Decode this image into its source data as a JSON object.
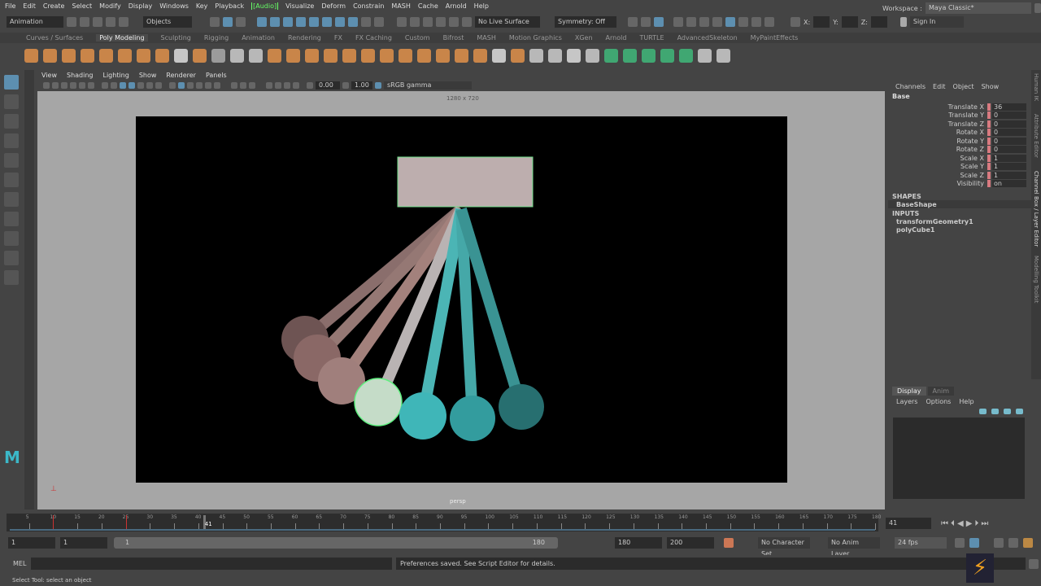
{
  "menu": [
    "File",
    "Edit",
    "Create",
    "Select",
    "Modify",
    "Display",
    "Windows",
    "Key",
    "Playback",
    "[Audio]",
    "Visualize",
    "Deform",
    "Constrain",
    "MASH",
    "Cache",
    "Arnold",
    "Help"
  ],
  "status": {
    "menuset": "Animation",
    "selection_mode": "Objects",
    "live_surface": "No Live Surface",
    "symmetry": "Symmetry: Off",
    "x_label": "X:",
    "y_label": "Y:",
    "z_label": "Z:",
    "sign_in": "Sign In",
    "workspace_label": "Workspace :",
    "workspace": "Maya Classic*"
  },
  "shelf_tabs": [
    "Curves / Surfaces",
    "Poly Modeling",
    "Sculpting",
    "Rigging",
    "Animation",
    "Rendering",
    "FX",
    "FX Caching",
    "Custom",
    "Bifrost",
    "MASH",
    "Motion Graphics",
    "XGen",
    "Arnold",
    "TURTLE",
    "AdvancedSkeleton",
    "MyPaintEffects"
  ],
  "active_shelf": "Poly Modeling",
  "viewport": {
    "menu": [
      "View",
      "Shading",
      "Lighting",
      "Show",
      "Renderer",
      "Panels"
    ],
    "exposure": "0.00",
    "gamma": "1.00",
    "color_space": "sRGB gamma",
    "resolution": "1280 x 720",
    "camera": "persp"
  },
  "channel_box": {
    "menu": [
      "Channels",
      "Edit",
      "Object",
      "Show"
    ],
    "object": "Base",
    "channels": [
      {
        "name": "Translate X",
        "value": "36"
      },
      {
        "name": "Translate Y",
        "value": "0"
      },
      {
        "name": "Translate Z",
        "value": "0"
      },
      {
        "name": "Rotate X",
        "value": "0"
      },
      {
        "name": "Rotate Y",
        "value": "0"
      },
      {
        "name": "Rotate Z",
        "value": "0"
      },
      {
        "name": "Scale X",
        "value": "1"
      },
      {
        "name": "Scale Y",
        "value": "1"
      },
      {
        "name": "Scale Z",
        "value": "1"
      },
      {
        "name": "Visibility",
        "value": "on"
      }
    ],
    "shapes_header": "SHAPES",
    "shape": "BaseShape",
    "inputs_header": "INPUTS",
    "inputs": [
      "transformGeometry1",
      "polyCube1"
    ]
  },
  "side_tabs": [
    "Human IK",
    "Attribute Editor",
    "Channel Box / Layer Editor",
    "Modelling Toolkit"
  ],
  "layer_editor": {
    "tabs": [
      "Display",
      "Anim"
    ],
    "menu": [
      "Layers",
      "Options",
      "Help"
    ]
  },
  "timeline": {
    "start": 1,
    "end": 180,
    "current_frame": "41",
    "tick_step": 5
  },
  "range": {
    "start": "1",
    "playback_start": "1",
    "slider_start": "1",
    "slider_end": "180",
    "playback_end": "180",
    "end": "200",
    "character_set": "No Character Set",
    "anim_layer": "No Anim Layer",
    "fps": "24 fps"
  },
  "command": {
    "lang": "MEL",
    "result": "Preferences saved. See Script Editor for details."
  },
  "help_line": "Select Tool: select an object"
}
